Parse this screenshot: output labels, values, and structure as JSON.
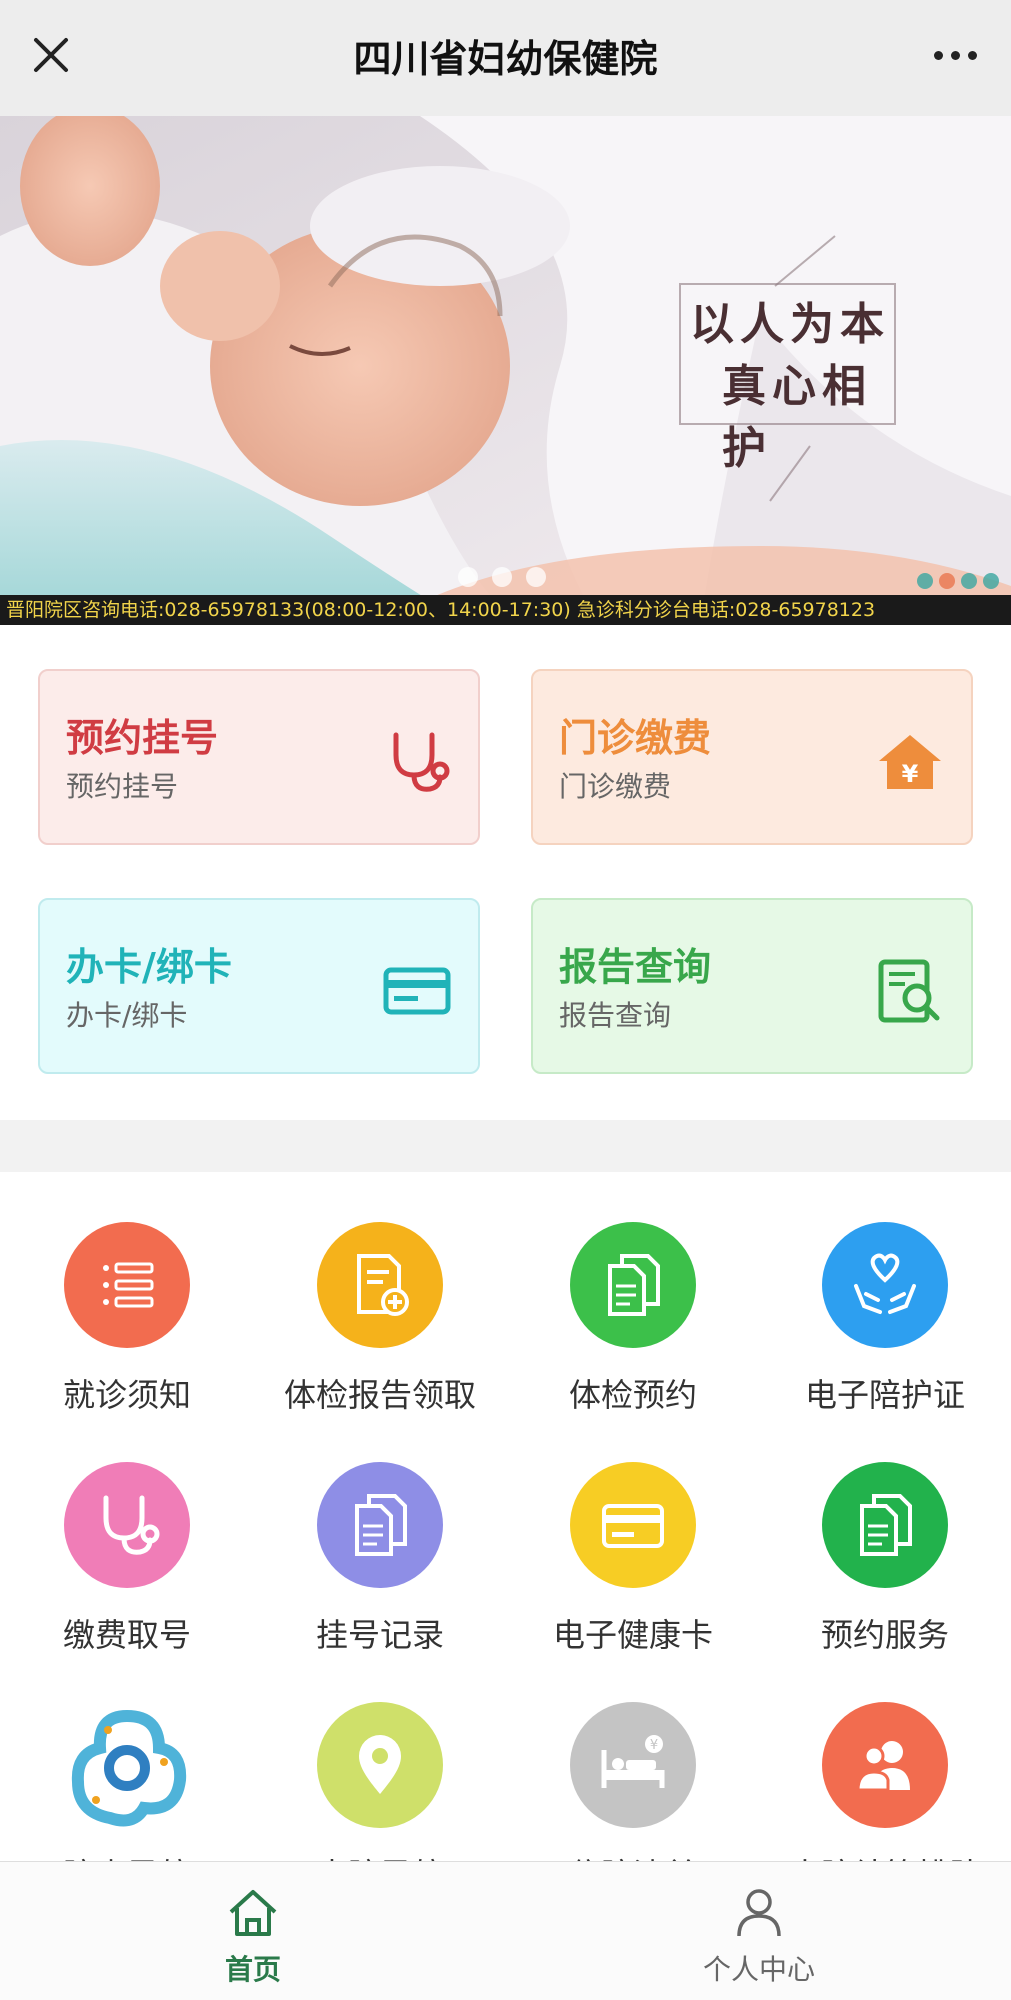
{
  "header": {
    "title": "四川省妇幼保健院"
  },
  "banner": {
    "slogan_line1": "以人为本",
    "slogan_line2": "真心相护",
    "ticker": "晋阳院区咨询电话:028-65978133(08:00-12:00、14:00-17:30)  急诊科分诊台电话:028-65978123"
  },
  "cards": [
    {
      "title": "预约挂号",
      "subtitle": "预约挂号",
      "icon": "stethoscope-icon",
      "color": "#d03c43"
    },
    {
      "title": "门诊缴费",
      "subtitle": "门诊缴费",
      "icon": "house-yen-icon",
      "color": "#ee8d3c"
    },
    {
      "title": "办卡/绑卡",
      "subtitle": "办卡/绑卡",
      "icon": "card-icon",
      "color": "#20b3b8"
    },
    {
      "title": "报告查询",
      "subtitle": "报告查询",
      "icon": "report-search-icon",
      "color": "#38a74b"
    }
  ],
  "grid": [
    {
      "label": "就诊须知",
      "icon": "list-icon",
      "color": "#f26c4f"
    },
    {
      "label": "体检报告领取",
      "icon": "document-add-icon",
      "color": "#f5b21b"
    },
    {
      "label": "体检预约",
      "icon": "documents-icon",
      "color": "#3cc04a"
    },
    {
      "label": "电子陪护证",
      "icon": "hands-heart-icon",
      "color": "#2d9ff0"
    },
    {
      "label": "缴费取号",
      "icon": "stethoscope-icon",
      "color": "#f07db7"
    },
    {
      "label": "挂号记录",
      "icon": "documents-icon",
      "color": "#8e8ee6"
    },
    {
      "label": "电子健康卡",
      "icon": "card-icon",
      "color": "#f7cd24"
    },
    {
      "label": "预约服务",
      "icon": "documents-icon",
      "color": "#22b24c"
    },
    {
      "label": "院内导航",
      "icon": "hospital-logo-icon",
      "color": "#4fb3d9"
    },
    {
      "label": "来院导航",
      "icon": "location-pin-icon",
      "color": "#cfe06a"
    },
    {
      "label": "住院清单",
      "icon": "bed-icon",
      "color": "#c4c4c4"
    },
    {
      "label": "出院结算排队",
      "icon": "people-icon",
      "color": "#f26c4f"
    }
  ],
  "bottom_nav": [
    {
      "label": "首页",
      "icon": "home-icon",
      "active": true
    },
    {
      "label": "个人中心",
      "icon": "person-icon",
      "active": false
    }
  ]
}
